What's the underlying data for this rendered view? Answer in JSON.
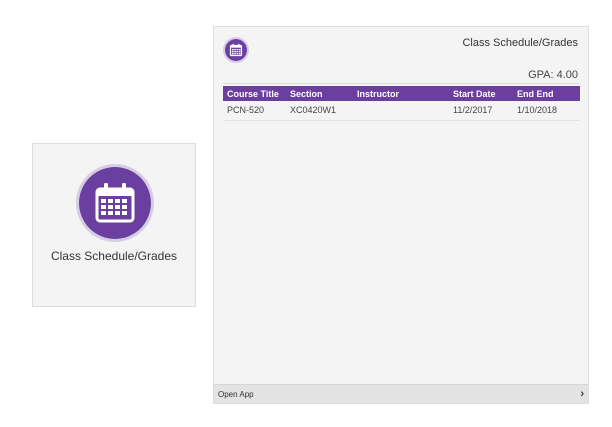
{
  "colors": {
    "accent": "#6a3fa0",
    "accent_border": "#d6cde3",
    "panel_bg": "#f4f4f4"
  },
  "tile": {
    "icon": "calendar-icon",
    "label": "Class Schedule/Grades"
  },
  "panel": {
    "icon": "calendar-icon",
    "title": "Class Schedule/Grades",
    "gpa": "GPA: 4.00",
    "table": {
      "headers": [
        "Course Title",
        "Section",
        "Instructor",
        "Start Date",
        "End End"
      ],
      "rows": [
        [
          "PCN-520",
          "XC0420W1",
          "",
          "11/2/2017",
          "1/10/2018"
        ]
      ]
    },
    "footer": {
      "label": "Open App",
      "chevron": "›"
    }
  }
}
